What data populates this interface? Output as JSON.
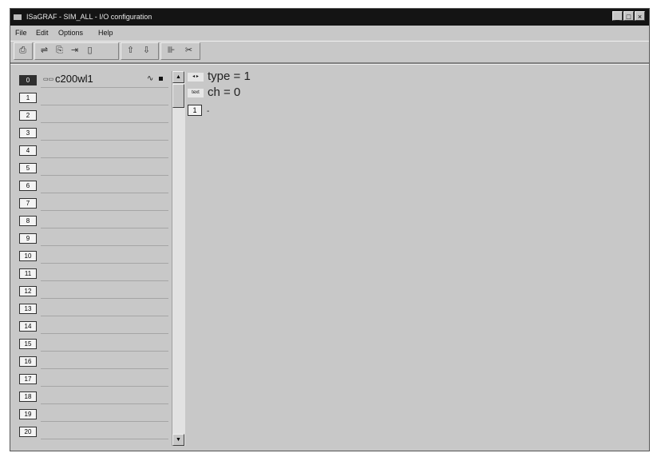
{
  "window": {
    "title": "ISaGRAF - SIM_ALL - I/O configuration",
    "controls": [
      "minimize",
      "maximize",
      "close"
    ]
  },
  "menu": [
    "File",
    "Edit",
    "Options",
    "Help"
  ],
  "toolbar": {
    "buttons": [
      "print-icon",
      "connect-icon",
      "copy-icon",
      "insert-icon",
      "delete-icon",
      "move-up-icon",
      "move-down-icon",
      "set-icon",
      "cut-icon"
    ]
  },
  "slots": {
    "numbers": [
      "0",
      "1",
      "2",
      "3",
      "4",
      "5",
      "6",
      "7",
      "8",
      "9",
      "10",
      "11",
      "12",
      "13",
      "14",
      "15",
      "16",
      "17",
      "18",
      "19",
      "20"
    ],
    "selected_index": 0,
    "first_board": {
      "type_icon": "io-icon",
      "name": "c200wl1"
    }
  },
  "details": {
    "type_label": "type = 1",
    "ch_label": "ch = 0",
    "channel_number": "1",
    "channel_marker": "-"
  }
}
